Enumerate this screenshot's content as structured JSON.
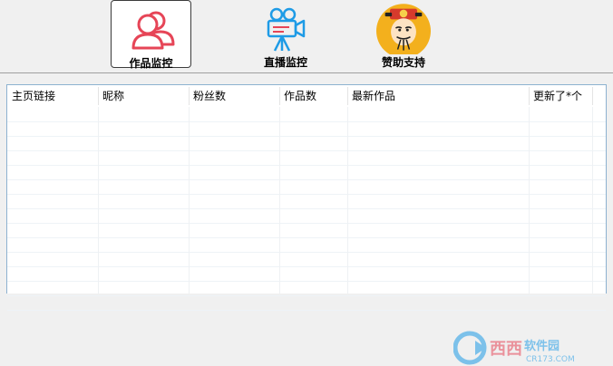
{
  "toolbar": {
    "buttons": [
      {
        "label": "作品监控",
        "icon": "users-icon",
        "active": true
      },
      {
        "label": "直播监控",
        "icon": "video-camera-icon",
        "active": false
      },
      {
        "label": "赞助支持",
        "icon": "god-of-wealth-icon",
        "active": false
      }
    ]
  },
  "table": {
    "columns": [
      "主页链接",
      "昵称",
      "粉丝数",
      "作品数",
      "最新作品",
      "更新了*个"
    ],
    "rows": []
  },
  "watermark": {
    "text": "西西软件园",
    "sub": "CR173.COM"
  },
  "colors": {
    "accent_red": "#e64557",
    "accent_blue": "#1e9be6",
    "grid_border": "#8db2d0"
  }
}
